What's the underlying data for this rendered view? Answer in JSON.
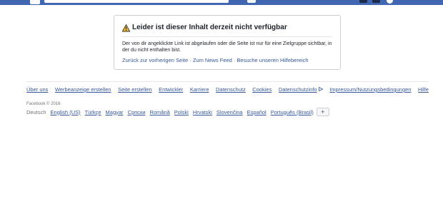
{
  "error_card": {
    "title": "Leider ist dieser Inhalt derzeit nicht verfügbar",
    "message": "Der von dir angeklickte Link ist abgelaufen oder die Seite ist nur für eine Zielgruppe sichtbar, in der du nicht enthalten bist.",
    "links": [
      "Zurück zur vorherigen Seite",
      "Zum News Feed",
      "Besuche unseren Hilfebereich"
    ],
    "separator": "·"
  },
  "footer": {
    "links": [
      "Über uns",
      "Werbeanzeige erstellen",
      "Seite erstellen",
      "Entwickler",
      "Karriere",
      "Datenschutz",
      "Cookies",
      "Datenschutzinfo",
      "Impressum/Nutzungsbedingungen",
      "Hilfe"
    ],
    "copyright": "Facebook © 2016",
    "current_language": "Deutsch",
    "languages": [
      "English (US)",
      "Türkçe",
      "Magyar",
      "Српски",
      "Română",
      "Polski",
      "Hrvatski",
      "Slovenčina",
      "Español",
      "Português (Brasil)"
    ],
    "more_languages_label": "+"
  },
  "colors": {
    "brand_blue": "#4267b2",
    "link": "#365899",
    "warning": "#f7b928"
  },
  "icons": {
    "warning": "warning-triangle-icon",
    "adchoices": "adchoices-icon",
    "logo": "facebook-logo-icon"
  }
}
